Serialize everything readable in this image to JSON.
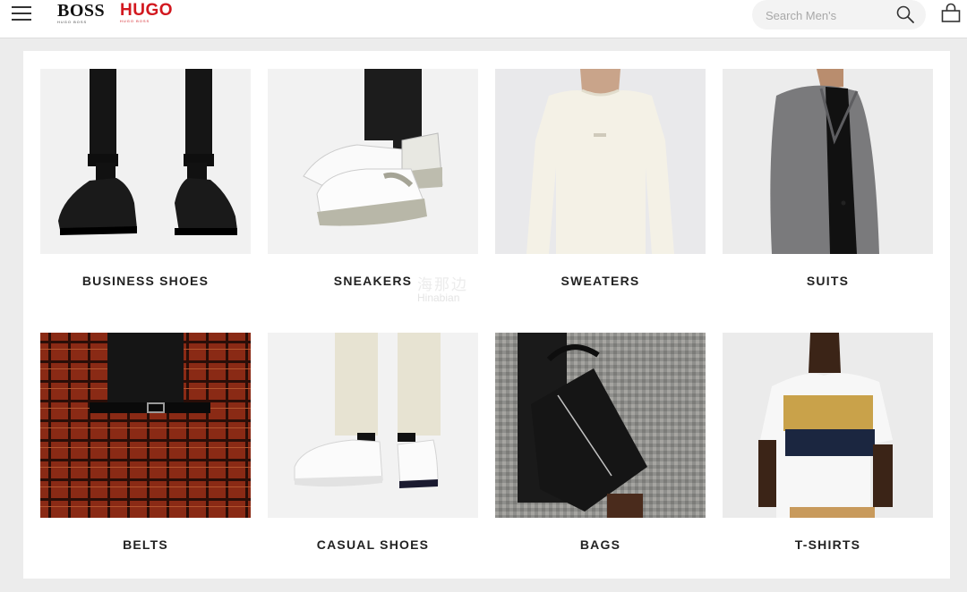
{
  "header": {
    "brand_boss": "BOSS",
    "brand_boss_sub": "HUGO BOSS",
    "brand_hugo": "HUGO",
    "brand_hugo_sub": "HUGO BOSS",
    "search_placeholder": "Search Men's",
    "icons": {
      "menu": "hamburger-menu-icon",
      "search": "search-icon",
      "bag": "shopping-bag-icon"
    },
    "colors": {
      "hugo_red": "#d2181f",
      "text": "#222222"
    }
  },
  "categories": [
    {
      "label": "BUSINESS SHOES",
      "image": "black leather derby shoes with dark trousers"
    },
    {
      "label": "SNEAKERS",
      "image": "white chunky sneakers with dark trousers"
    },
    {
      "label": "SWEATERS",
      "image": "cream crew-neck sweater"
    },
    {
      "label": "SUITS",
      "image": "grey blazer over black shirt"
    },
    {
      "label": "BELTS",
      "image": "black belt on red check suit"
    },
    {
      "label": "CASUAL SHOES",
      "image": "white leather sneakers with cream trousers"
    },
    {
      "label": "BAGS",
      "image": "black leather briefcase"
    },
    {
      "label": "T-SHIRTS",
      "image": "white printed t-shirt with navy stripe"
    }
  ],
  "watermark": {
    "line1": "海那边",
    "line2": "Hinabian"
  }
}
